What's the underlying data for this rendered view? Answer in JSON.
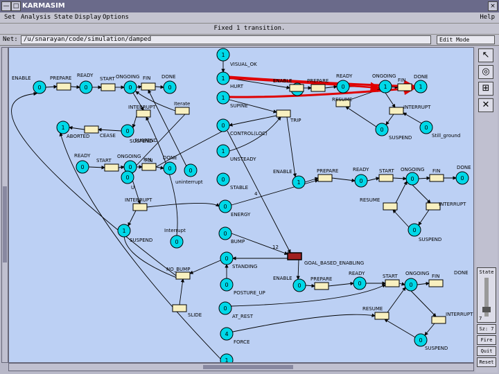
{
  "window": {
    "title": "KARMASIM"
  },
  "titlebar_controls": [
    "—",
    "□",
    "×"
  ],
  "menu": [
    "Set",
    "Analysis",
    "State",
    "Display",
    "Options"
  ],
  "menu_help": "Help",
  "status_text": "Fixed 1 transition.",
  "path": {
    "label": "Net:",
    "value": "/u/snarayan/code/simulation/damped",
    "mode": "Edit Mode"
  },
  "tools": [
    "pointer-icon",
    "place-icon",
    "transition-icon",
    "delete-icon"
  ],
  "side_buttons": [
    {
      "name": "step-button",
      "label": "State"
    },
    {
      "name": "fire-button",
      "label": "Fire"
    },
    {
      "name": "quit-button",
      "label": "Quit"
    },
    {
      "name": "reset-button",
      "label": "Reset"
    }
  ],
  "slider": {
    "label": "",
    "value": "7",
    "extra": "Sz: 7"
  },
  "colors": {
    "place_fill": "#00d8e8",
    "transition_fill": "#f8f0c0",
    "fired_transition": "#a02020",
    "highlight_arc": "#e00000",
    "canvas": "#bcd0f4"
  },
  "places": [
    {
      "id": "p1",
      "token": "0",
      "label": ""
    },
    {
      "id": "p2",
      "token": "0",
      "label": ""
    },
    {
      "id": "p3",
      "token": "0",
      "label": ""
    },
    {
      "id": "p4",
      "token": "0",
      "label": ""
    },
    {
      "id": "p5",
      "token": "1",
      "label": ""
    },
    {
      "id": "p6",
      "token": "0",
      "label": "SUSPEND"
    },
    {
      "id": "p7",
      "token": "0",
      "label": ""
    },
    {
      "id": "p8",
      "token": "0",
      "label": ""
    },
    {
      "id": "p9",
      "token": "0",
      "label": ""
    },
    {
      "id": "p10",
      "token": "0",
      "label": ""
    },
    {
      "id": "p11",
      "token": "0",
      "label": ""
    },
    {
      "id": "p12",
      "token": "1",
      "label": "SUSPEND"
    },
    {
      "id": "p13",
      "token": "0",
      "label": ""
    },
    {
      "id": "p14",
      "token": "1",
      "label": "VISUAL_OK"
    },
    {
      "id": "p15",
      "token": "1",
      "label": "HURT"
    },
    {
      "id": "p16",
      "token": "1",
      "label": "SUPINE"
    },
    {
      "id": "p17",
      "token": "0",
      "label": "CONTROL(LOC)"
    },
    {
      "id": "p18",
      "token": "1",
      "label": "UNSTEADY"
    },
    {
      "id": "p19",
      "token": "0",
      "label": "STABLE"
    },
    {
      "id": "p20",
      "token": "0",
      "label": "ENERGY"
    },
    {
      "id": "p21",
      "token": "0",
      "label": "BUMP"
    },
    {
      "id": "p22",
      "token": "0",
      "label": "STANDING"
    },
    {
      "id": "p23",
      "token": "0",
      "label": "POSTURE_UP"
    },
    {
      "id": "p24",
      "token": "0",
      "label": "AT_REST"
    },
    {
      "id": "p25",
      "token": "4",
      "label": "FORCE"
    },
    {
      "id": "p26",
      "token": "1",
      "label": ""
    },
    {
      "id": "p27",
      "token": "0",
      "label": ""
    },
    {
      "id": "p28",
      "token": "0",
      "label": ""
    },
    {
      "id": "p29",
      "token": "1",
      "label": ""
    },
    {
      "id": "p30",
      "token": "0",
      "label": "SUSPEND"
    },
    {
      "id": "p31",
      "token": "0",
      "label": "Still_ground"
    },
    {
      "id": "p32",
      "token": "1",
      "label": ""
    },
    {
      "id": "p33",
      "token": "0",
      "label": ""
    },
    {
      "id": "p34",
      "token": "0",
      "label": ""
    },
    {
      "id": "p35",
      "token": "0",
      "label": ""
    },
    {
      "id": "p36",
      "token": "0",
      "label": "SUSPEND"
    },
    {
      "id": "p37",
      "token": "0",
      "label": ""
    },
    {
      "id": "p38",
      "token": "0",
      "label": ""
    },
    {
      "id": "p39",
      "token": "0",
      "label": ""
    },
    {
      "id": "p40",
      "token": "0",
      "label": "SUSPEND"
    },
    {
      "id": "p41",
      "token": "1",
      "label": ""
    }
  ],
  "transitions": [
    {
      "id": "t1",
      "label": "PREPARE",
      "fired": false
    },
    {
      "id": "t2",
      "label": "START",
      "fired": false
    },
    {
      "id": "t3",
      "label": "FIN",
      "fired": false
    },
    {
      "id": "t4",
      "label": "INTERRUPT",
      "fired": false
    },
    {
      "id": "t5",
      "label": "Iterate",
      "fired": false
    },
    {
      "id": "t6",
      "label": "CEASE",
      "fired": false
    },
    {
      "id": "t7",
      "label": "START",
      "fired": false
    },
    {
      "id": "t8",
      "label": "FIN",
      "fired": false
    },
    {
      "id": "t9",
      "label": "INTERRUPT",
      "fired": false
    },
    {
      "id": "t10",
      "label": "ENABLE",
      "fired": false
    },
    {
      "id": "t11",
      "label": "PREPARE",
      "fired": false
    },
    {
      "id": "t12",
      "label": "FIN",
      "fired": false
    },
    {
      "id": "t13",
      "label": "RESUME",
      "fired": false
    },
    {
      "id": "t14",
      "label": "INTERRUPT",
      "fired": false
    },
    {
      "id": "t15",
      "label": "TRIP",
      "fired": false
    },
    {
      "id": "t16",
      "label": "PREPARE",
      "fired": false
    },
    {
      "id": "t17",
      "label": "START",
      "fired": false
    },
    {
      "id": "t18",
      "label": "FIN",
      "fired": false
    },
    {
      "id": "t19",
      "label": "RESUME",
      "fired": false
    },
    {
      "id": "t20",
      "label": "INTERRUPT",
      "fired": false
    },
    {
      "id": "t21",
      "label": "GOAL_BASED_ENABLING",
      "fired": true
    },
    {
      "id": "t22",
      "label": "PREPARE",
      "fired": false
    },
    {
      "id": "t23",
      "label": "START",
      "fired": false
    },
    {
      "id": "t24",
      "label": "FIN",
      "fired": false
    },
    {
      "id": "t25",
      "label": "RESUME",
      "fired": false
    },
    {
      "id": "t26",
      "label": "INTERRUPT",
      "fired": false
    },
    {
      "id": "t27",
      "label": "NO_BUMP",
      "fired": false
    },
    {
      "id": "t28",
      "label": "SLIDE",
      "fired": false
    }
  ],
  "text_labels": {
    "enable_l": "ENABLE",
    "ready_l": "READY",
    "ongoing_l": "ONGOING",
    "done_l": "DONE",
    "aborted": "ABORTED",
    "suspend1": "SUSPEND",
    "ready2": "READY",
    "ongoing2": "ONGOING",
    "done2": "DONE",
    "fin2": "FIN",
    "u": "U",
    "interrupt_lbl": "Interrupt",
    "uninterrupt": "uninterrupt",
    "ready3": "READY",
    "ongoing3": "ONGOING",
    "done3": "DONE",
    "enable3": "ENABLE",
    "ready4": "READY",
    "ongoing4": "ONGOING",
    "done4": "DONE",
    "enable4": "ENABLE",
    "ready5": "READY",
    "ongoing5": "ONGOING",
    "done5": "DONE",
    "enable5": "ENABLE",
    "n12": "12",
    "n4": "4"
  }
}
